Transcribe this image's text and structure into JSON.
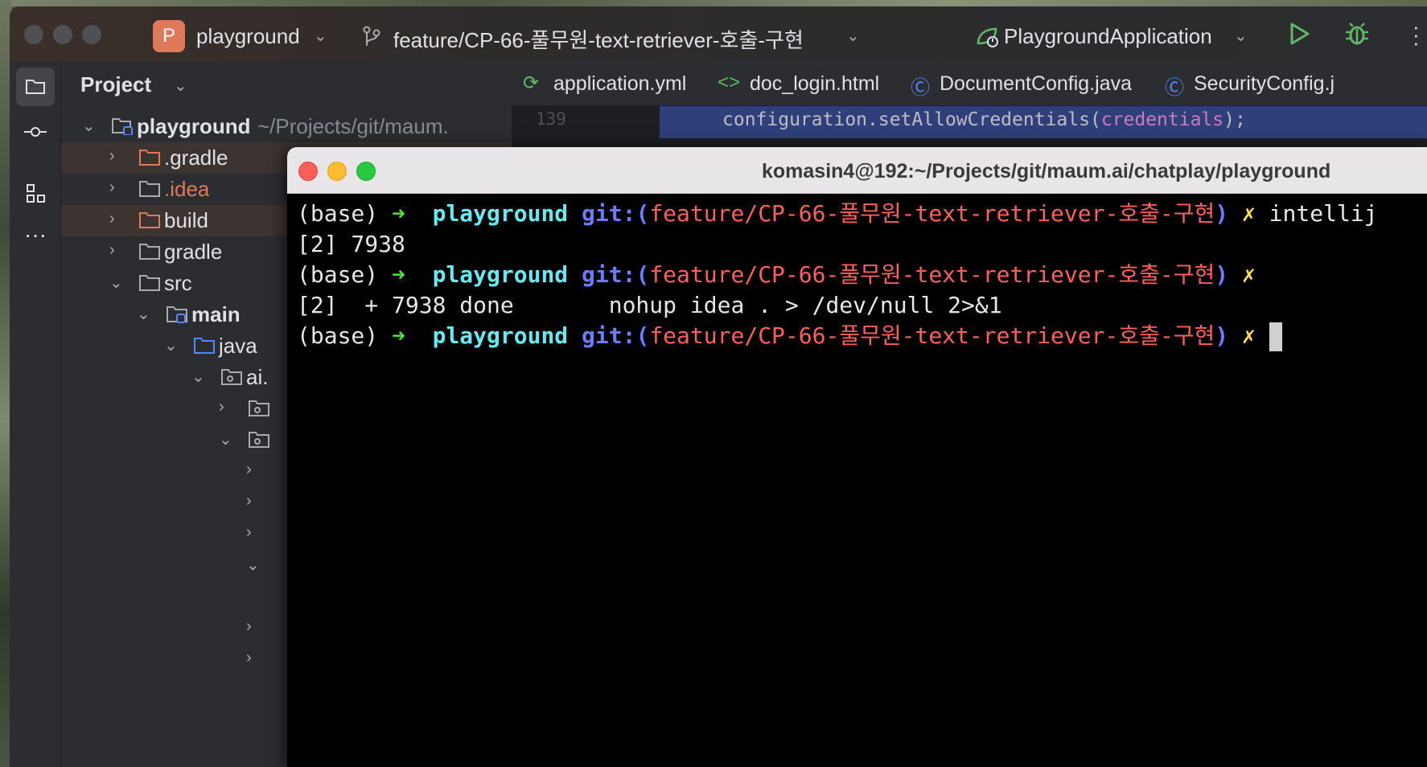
{
  "titlebar": {
    "project_badge": "P",
    "project_name": "playground",
    "branch": "feature/CP-66-풀무원-text-retriever-호출-구현",
    "run_config": "PlaygroundApplication"
  },
  "project_panel": {
    "title": "Project",
    "root_name": "playground",
    "root_path": "~/Projects/git/maum.",
    "items": [
      {
        "label": ".gradle"
      },
      {
        "label": ".idea"
      },
      {
        "label": "build"
      },
      {
        "label": "gradle"
      },
      {
        "label": "src"
      },
      {
        "label": "main"
      },
      {
        "label": "java"
      },
      {
        "label": "ai."
      }
    ]
  },
  "editor": {
    "tabs": [
      {
        "label": "application.yml",
        "icon": "spring-icon"
      },
      {
        "label": "doc_login.html",
        "icon": "html-icon"
      },
      {
        "label": "DocumentConfig.java",
        "icon": "class-icon"
      },
      {
        "label": "SecurityConfig.j",
        "icon": "class-icon"
      }
    ],
    "line_number": "139",
    "code_prefix": "configuration.setAllowCredentials(",
    "code_arg": "credentials",
    "code_suffix": ");"
  },
  "terminal": {
    "title": "komasin4@192:~/Projects/git/maum.ai/chatplay/playground",
    "prompt_env": "(base)",
    "prompt_arrow": "➜",
    "prompt_dir": "playground",
    "git_prefix": "git:(",
    "git_branch": "feature/CP-66-풀무원-text-retriever-호출-구현",
    "git_suffix": ")",
    "dirty_mark": "✗",
    "line1_cmd": "intellij",
    "line2": "[2] 7938",
    "line4": "[2]  + 7938 done       nohup idea . > /dev/null 2>&1"
  },
  "colors": {
    "accent_orange": "#e0795a",
    "run_green": "#5fb865",
    "terminal_red": "#ff5f5f",
    "terminal_cyan": "#68e8f0"
  }
}
